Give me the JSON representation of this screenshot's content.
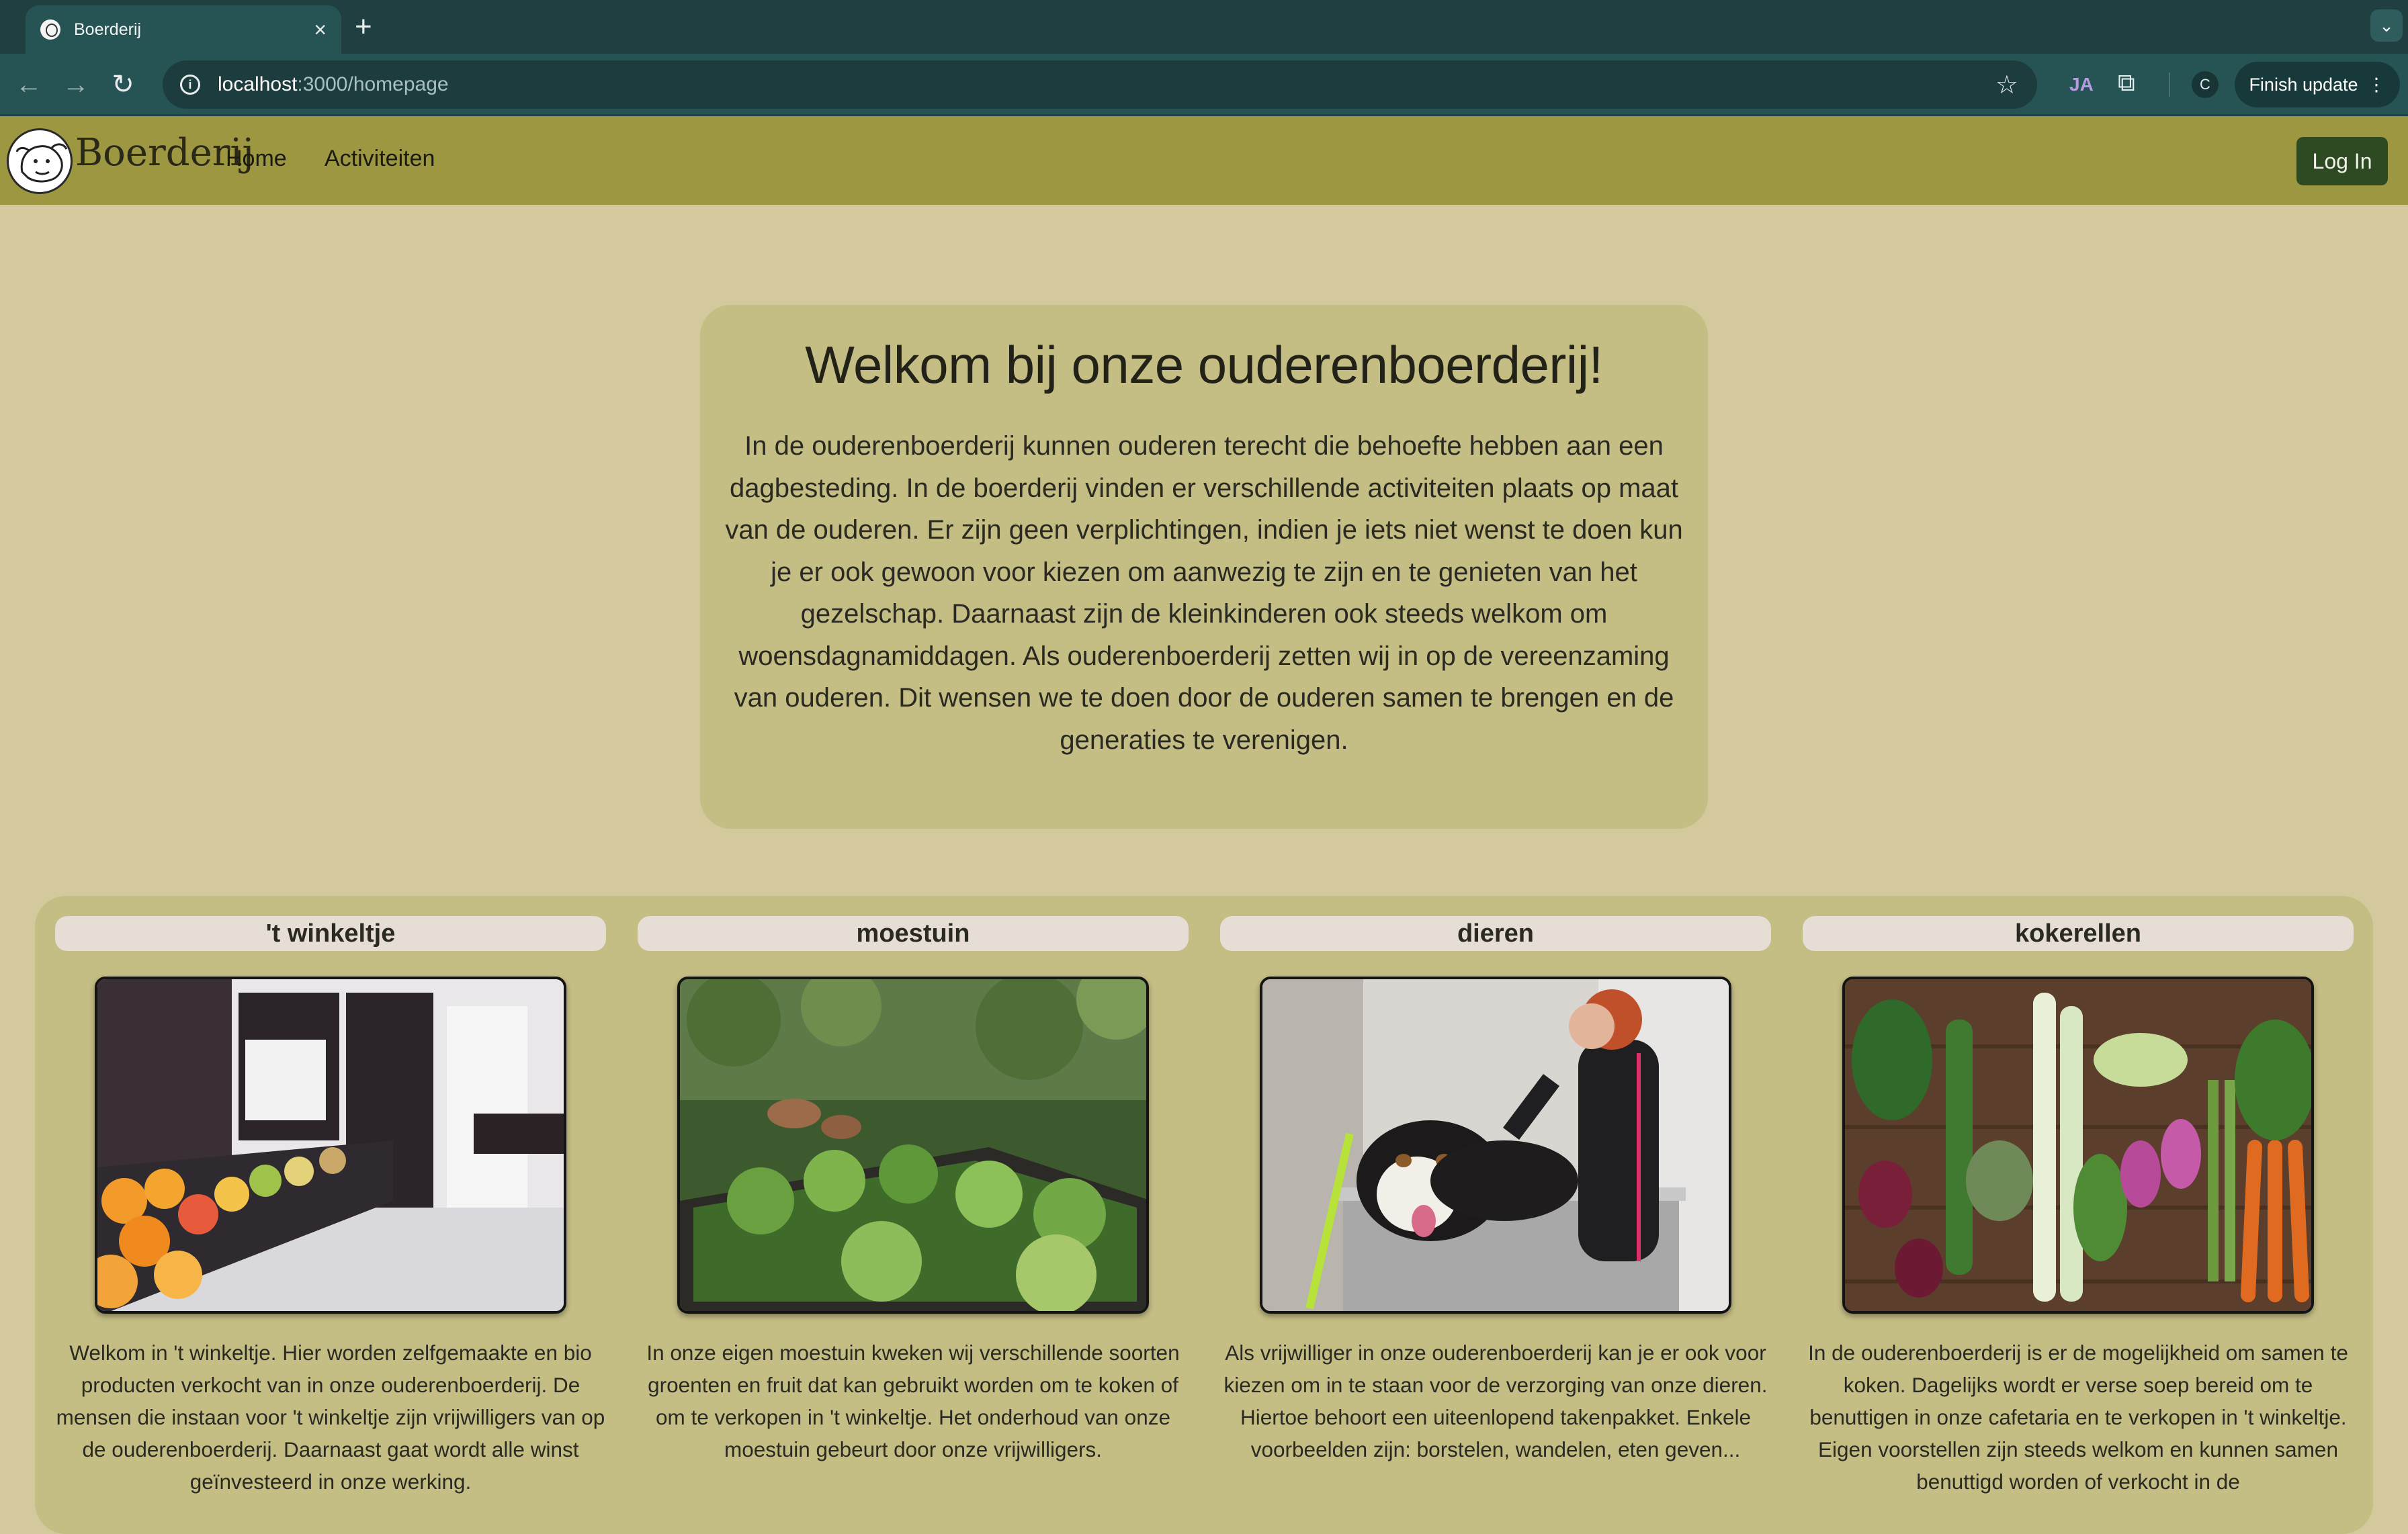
{
  "browser": {
    "tab_title": "Boerderij",
    "tab_close": "×",
    "new_tab": "+",
    "tab_menu": "⌄",
    "back": "←",
    "forward": "→",
    "reload": "↻",
    "url_host": "localhost",
    "url_path": ":3000/homepage",
    "star": "☆",
    "ja_label": "JA",
    "puzzle": "⧉",
    "profile_initial": "C",
    "finish_update": "Finish update",
    "finish_menu": "⋮"
  },
  "navbar": {
    "brand": "Boerderij",
    "links": [
      "Home",
      "Activiteiten"
    ],
    "login": "Log In"
  },
  "welcome": {
    "title": "Welkom bij onze ouderenboerderij!",
    "text": "In de ouderenboerderij kunnen ouderen terecht die behoefte hebben aan een dagbesteding. In de boerderij vinden er verschillende activiteiten plaats op maat van de ouderen. Er zijn geen verplichtingen, indien je iets niet wenst te doen kun je er ook gewoon voor kiezen om aanwezig te zijn en te genieten van het gezelschap. Daarnaast zijn de kleinkinderen ook steeds welkom om woensdagnamiddagen. Als ouderenboerderij zetten wij in op de vereenzaming van ouderen. Dit wensen we te doen door de ouderen samen te brengen en de generaties te verenigen."
  },
  "cards": [
    {
      "title": "'t winkeltje",
      "text": "Welkom in 't winkeltje. Hier worden zelfgemaakte en bio producten verkocht van in onze ouderenboerderij. De mensen die instaan voor 't winkeltje zijn vrijwilligers van op de ouderenboerderij. Daarnaast gaat wordt alle winst geïnvesteerd in onze werking."
    },
    {
      "title": "moestuin",
      "text": "In onze eigen moestuin kweken wij verschillende soorten groenten en fruit dat kan gebruikt worden om te koken of om te verkopen in 't winkeltje. Het onderhoud van onze moestuin gebeurt door onze vrijwilligers."
    },
    {
      "title": "dieren",
      "text": "Als vrijwilliger in onze ouderenboerderij kan je er ook voor kiezen om in te staan voor de verzorging van onze dieren. Hiertoe behoort een uiteenlopend takenpakket. Enkele voorbeelden zijn: borstelen, wandelen, eten geven..."
    },
    {
      "title": "kokerellen",
      "text": "In de ouderenboerderij is er de mogelijkheid om samen te koken. Dagelijks wordt er verse soep bereid om te benuttigen in onze cafetaria en te verkopen in 't winkeltje. Eigen voorstellen zijn steeds welkom en kunnen samen benuttigd worden of verkocht in de"
    }
  ]
}
